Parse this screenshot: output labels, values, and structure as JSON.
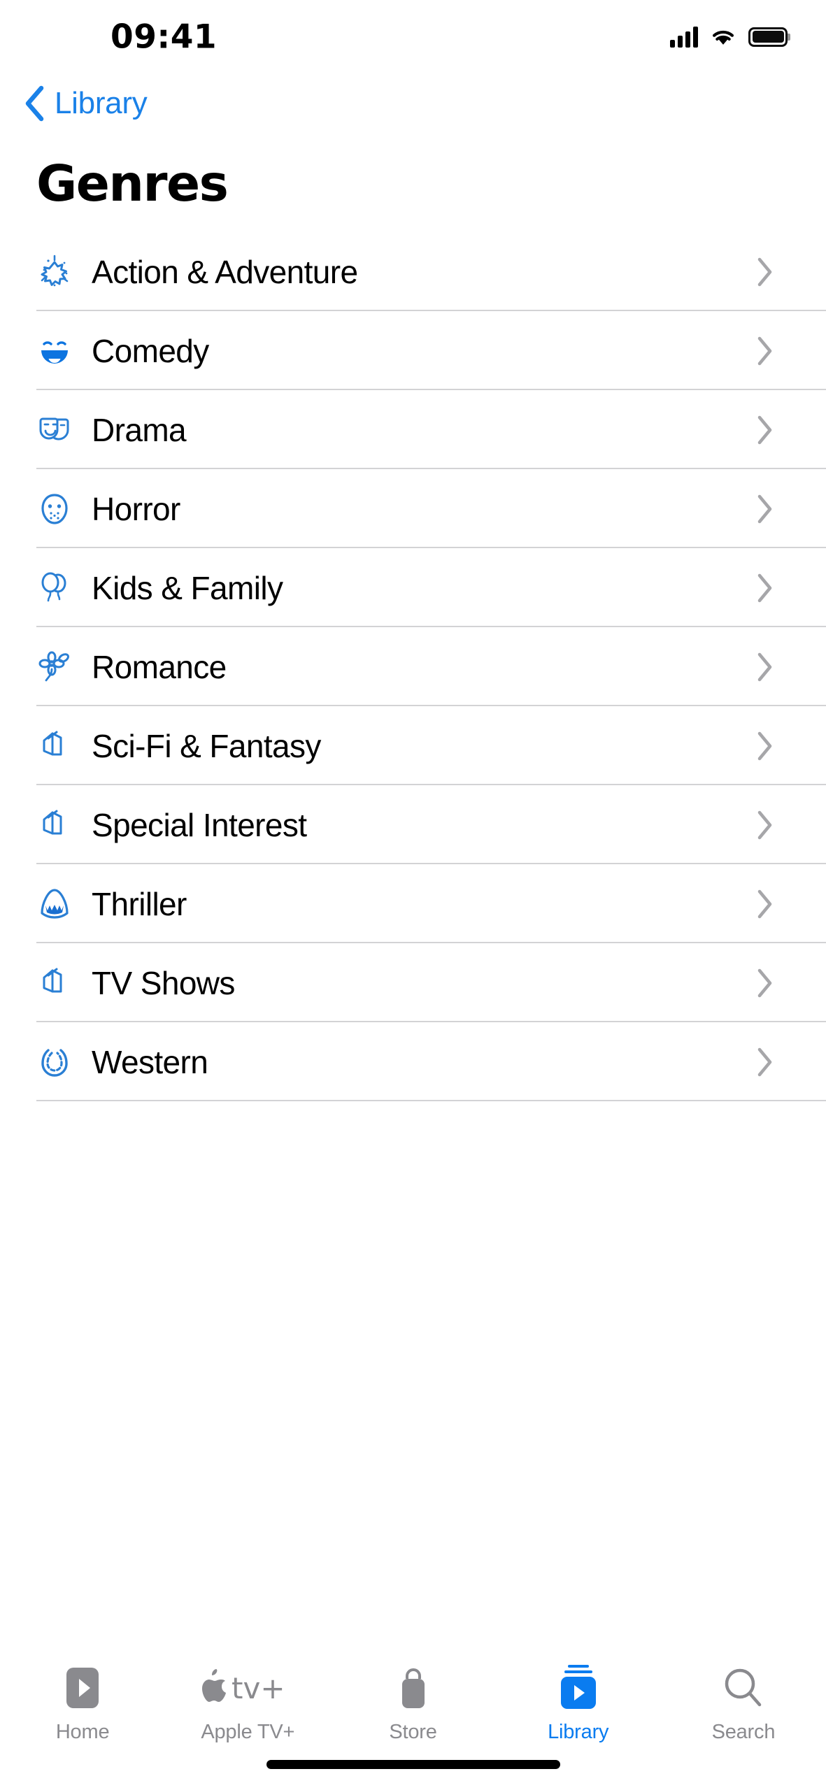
{
  "status_bar": {
    "time": "09:41",
    "cellular_icon": "signal-bars-icon",
    "wifi_icon": "wifi-icon",
    "battery_icon": "battery-full-icon"
  },
  "nav": {
    "back_icon": "chevron-left-icon",
    "back_label": "Library"
  },
  "page_title": "Genres",
  "colors": {
    "accent": "#1a81e8",
    "tab_active": "#0a7cf0",
    "tab_inactive": "#8a8a8e",
    "separator": "#d3d3d5",
    "chevron": "#a6a6a9",
    "background": "#ffffff"
  },
  "genres": [
    {
      "label": "Action & Adventure",
      "icon": "starburst-icon",
      "chevron": "chevron-right-icon"
    },
    {
      "label": "Comedy",
      "icon": "laughing-face-icon",
      "chevron": "chevron-right-icon"
    },
    {
      "label": "Drama",
      "icon": "theater-masks-icon",
      "chevron": "chevron-right-icon"
    },
    {
      "label": "Horror",
      "icon": "hockey-mask-icon",
      "chevron": "chevron-right-icon"
    },
    {
      "label": "Kids & Family",
      "icon": "balloons-icon",
      "chevron": "chevron-right-icon"
    },
    {
      "label": "Romance",
      "icon": "flower-icon",
      "chevron": "chevron-right-icon"
    },
    {
      "label": "Sci-Fi & Fantasy",
      "icon": "book-stack-icon",
      "chevron": "chevron-right-icon"
    },
    {
      "label": "Special Interest",
      "icon": "book-stack-icon",
      "chevron": "chevron-right-icon"
    },
    {
      "label": "Thriller",
      "icon": "shark-jaws-icon",
      "chevron": "chevron-right-icon"
    },
    {
      "label": "TV Shows",
      "icon": "book-stack-icon",
      "chevron": "chevron-right-icon"
    },
    {
      "label": "Western",
      "icon": "horseshoe-icon",
      "chevron": "chevron-right-icon"
    }
  ],
  "tab_bar": {
    "items": [
      {
        "label": "Home",
        "icon": "play-rect-icon",
        "active": false
      },
      {
        "label": "Apple TV+",
        "icon": "apple-tvplus-icon",
        "active": false
      },
      {
        "label": "Store",
        "icon": "shopping-bag-icon",
        "active": false
      },
      {
        "label": "Library",
        "icon": "library-play-icon",
        "active": true
      },
      {
        "label": "Search",
        "icon": "magnifier-icon",
        "active": false
      }
    ]
  }
}
